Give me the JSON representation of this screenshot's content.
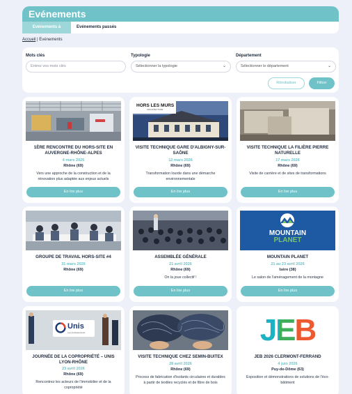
{
  "header": {
    "title": "Evénements"
  },
  "tabs": [
    {
      "label": "Evénements à venir",
      "active": true
    },
    {
      "label": "Evénements passés",
      "active": false
    }
  ],
  "breadcrumb": {
    "home": "Accueil",
    "separator": " | ",
    "current": "Evénements"
  },
  "filters": {
    "keywords_label": "Mots clés",
    "keywords_placeholder": "Entrez vos mots clés",
    "typologie_label": "Typologie",
    "typologie_value": "Sélectionner la typologie",
    "departement_label": "Département",
    "departement_value": "Sélectionner le département",
    "reset_label": "Réinitialiser",
    "filter_label": "Filtrer"
  },
  "cards": [
    {
      "title": "1ÈRE RENCONTRE DU HORS-SITE EN AUVERGNE-RHÔNE-ALPES",
      "date": "4 mars 2026",
      "location": "Rhône (69)",
      "description": "Vers une approche de la construction et de la rénovation plus adaptée aux enjeux actuels",
      "button": "En lire plus",
      "image": "factory-photo"
    },
    {
      "title": "VISITE TECHNIQUE GARE D'ALBIGNY-SUR-SAÔNE",
      "date": "12 mars 2026",
      "location": "Rhône (69)",
      "description": "Transformation lourde dans une démarche environnementale",
      "button": "En lire plus",
      "image": "station-photo",
      "logo_text": "HORS LES MURS",
      "logo_sub": "ARCHITECTURE"
    },
    {
      "title": "VISITE TECHNIQUE LA FILIÈRE PIERRE NATURELLE",
      "date": "17 mars 2026",
      "location": "Rhône (69)",
      "description": "Visite de carrière et de sites de transformations",
      "button": "En lire plus",
      "image": "stone-photo"
    },
    {
      "title": "GROUPE DE TRAVAIL HORS-SITE #4",
      "date": "31 mars 2026",
      "location": "Rhône (69)",
      "description": "",
      "button": "En lire plus",
      "image": "meeting-photo"
    },
    {
      "title": "ASSEMBLÉE GÉNÉRALE",
      "date": "21 avril 2026",
      "location": "Rhône (69)",
      "description": "On la joue collectif !",
      "button": "En lire plus",
      "image": "assembly-photo"
    },
    {
      "title": "MOUNTAIN PLANET",
      "date": "21 au 23 avril 2026",
      "location": "Isère (38)",
      "description": "Le salon de l'aménagement de la montagne",
      "button": "En lire plus",
      "image": "mountain-logo",
      "logo_text_1": "MOUNTAIN",
      "logo_text_2": "PLANET"
    },
    {
      "title": "JOURNÉE DE LA COPROPRIÉTÉ – UNIS LYON-RHÔNE",
      "date": "23 avril 2026",
      "location": "Rhône (69)",
      "description": "Rencontrez les acteurs de l'immobilier et de la copropriété",
      "button": "En lire plus",
      "image": "unis-photo",
      "logo_text": "Unis",
      "logo_sub": "Les professionnels"
    },
    {
      "title": "VISITE TECHNIQUE CHEZ SEMIN-BUITEX",
      "date": "28 avril 2026",
      "location": "Rhône (69)",
      "description": "Process de fabrication d'isolants circulaires et durables à partir de textiles recyclés et de fibre de bois",
      "button": "En lire plus",
      "image": "textile-photo"
    },
    {
      "title": "JEB 2026 CLERMONT-FERRAND",
      "date": "4 juin 2026",
      "location": "Puy-de-Dôme (63)",
      "description": "Exposition et démonstrations de solutions de l'éco-bâtiment",
      "button": "En lire plus",
      "image": "jeb-logo",
      "logo_text": "JEB"
    }
  ],
  "colors": {
    "accent": "#6fc2c7",
    "accent_light": "#9dd7da",
    "background": "#eef0f9",
    "text": "#1f2a3c"
  }
}
